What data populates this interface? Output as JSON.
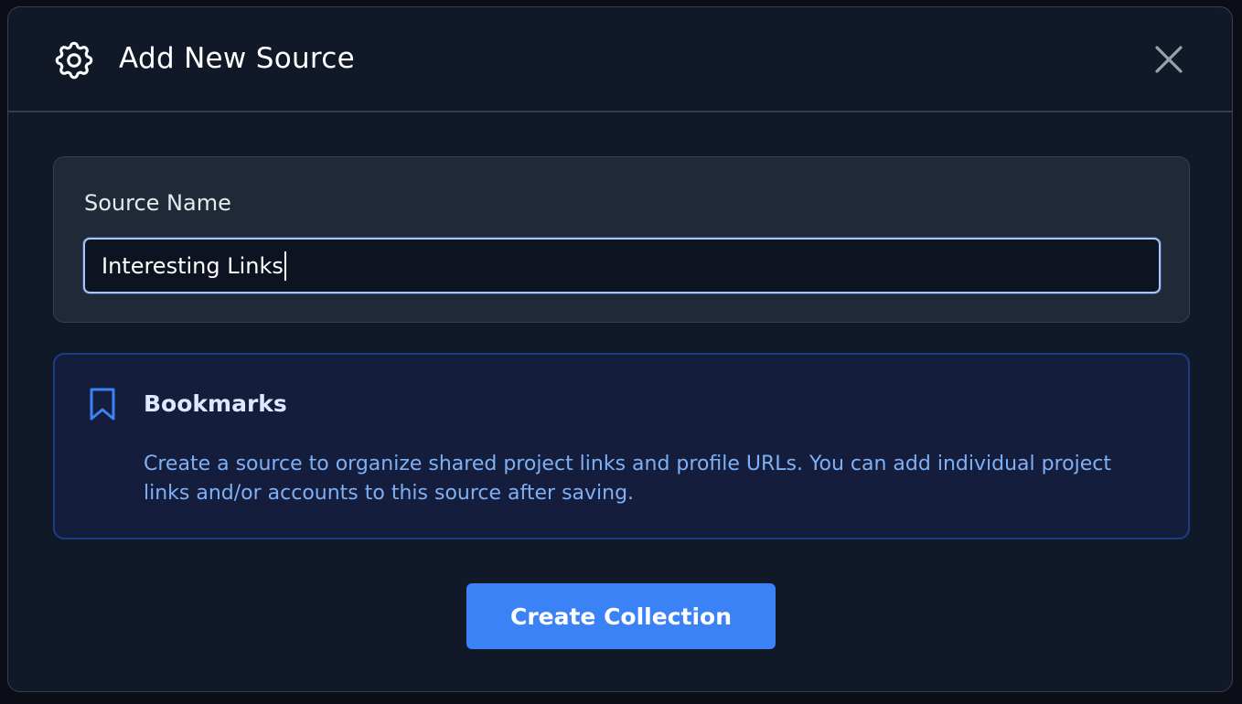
{
  "dialog": {
    "title": "Add New Source",
    "header_icon": "gear-icon",
    "close_icon": "close-icon"
  },
  "source_name": {
    "label": "Source Name",
    "value": "Interesting Links"
  },
  "info": {
    "icon": "bookmark-icon",
    "title": "Bookmarks",
    "description": "Create a source to organize shared project links and profile URLs. You can add individual project links and/or accounts to this source after saving."
  },
  "actions": {
    "create_label": "Create Collection"
  },
  "colors": {
    "accent": "#3b82f6",
    "dialog_bg": "#111827",
    "info_bg": "#141d3c",
    "info_text": "#7fb0f5"
  }
}
